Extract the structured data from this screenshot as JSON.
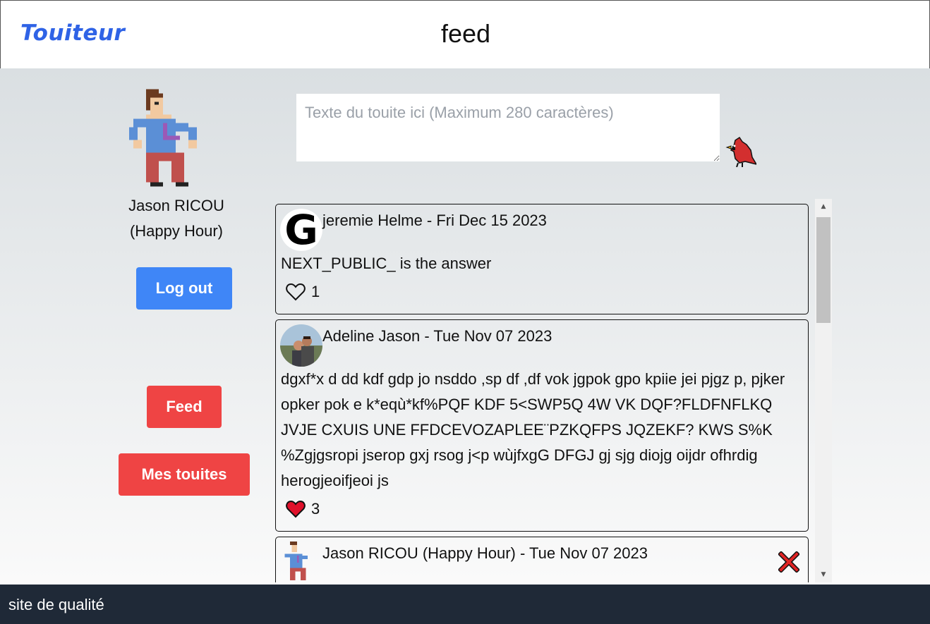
{
  "header": {
    "logo": "Touiteur",
    "title": "feed"
  },
  "sidebar": {
    "user_name_line1": "Jason RICOU",
    "user_name_line2": "(Happy Hour)",
    "logout_label": "Log out",
    "feed_label": "Feed",
    "my_touites_label": "Mes touites"
  },
  "compose": {
    "placeholder": "Texte du touite ici (Maximum 280 caractères)",
    "value": "",
    "send_icon": "cardinal-bird-icon"
  },
  "touites": [
    {
      "avatar": "letter-g-avatar",
      "author": "jeremie Helme",
      "date": "Fri Dec 15 2023",
      "meta": "jeremie Helme - Fri Dec 15 2023",
      "body": "NEXT_PUBLIC_ is the answer",
      "likes": "1",
      "liked": false
    },
    {
      "avatar": "couple-photo-avatar",
      "author": "Adeline Jason",
      "date": "Tue Nov 07 2023",
      "meta": "Adeline Jason - Tue Nov 07 2023",
      "body": "dgxf*x d dd kdf gdp jo nsddo ,sp df ,df vok jgpok gpo kpiie jei pjgz p, pjker opker pok e k*eqù*kf%PQF KDF 5<SWP5Q 4W VK DQF?FLDFNFLKQ JVJE CXUIS UNE FFDCEVOZAPLEE¨PZKQFPS JQZEKF? KWS S%K %Zgjgsropi jserop gxj rsog j<p wùjfxgG DFGJ gj sjg diojg oijdr ofhrdig herogjeoifjeoi js",
      "likes": "3",
      "liked": true
    },
    {
      "avatar": "pixel-man-avatar",
      "author": "Jason RICOU (Happy Hour)",
      "date": "Tue Nov 07 2023",
      "meta": "Jason RICOU (Happy Hour) - Tue Nov 07 2023",
      "deletable": true
    }
  ],
  "colors": {
    "logo": "#2f63e6",
    "primary_button": "#3f86f7",
    "danger_button": "#ef4444",
    "footer_bg": "#1f2937"
  },
  "footer": {
    "text": "site de qualité"
  }
}
